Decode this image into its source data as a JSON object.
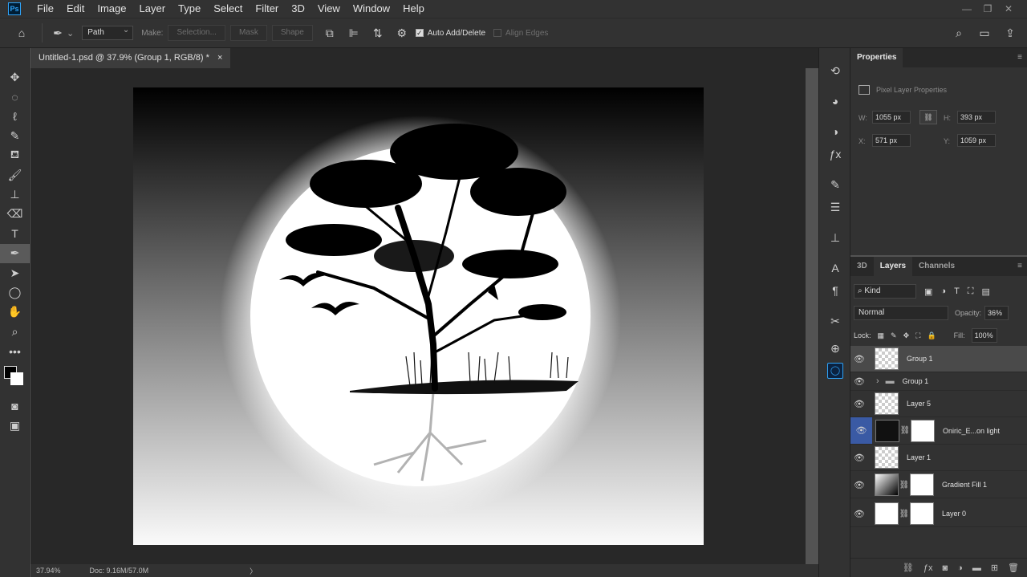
{
  "menubar": {
    "logo": "Ps",
    "items": [
      "File",
      "Edit",
      "Image",
      "Layer",
      "Type",
      "Select",
      "Filter",
      "3D",
      "View",
      "Window",
      "Help"
    ],
    "win_min": "—",
    "win_restore": "❐",
    "win_close": "✕"
  },
  "options": {
    "mode": "Path",
    "make_label": "Make:",
    "selection_btn": "Selection...",
    "mask_btn": "Mask",
    "shape_btn": "Shape",
    "auto_add_delete": "Auto Add/Delete",
    "align_edges": "Align Edges"
  },
  "document": {
    "tab_title": "Untitled-1.psd @ 37.9% (Group 1, RGB/8) *",
    "close": "×",
    "zoom": "37.94%",
    "doc_size": "Doc: 9.16M/57.0M",
    "status_arrow": "〉"
  },
  "properties": {
    "tab": "Properties",
    "section_title": "Pixel Layer Properties",
    "w_label": "W:",
    "w_value": "1055 px",
    "h_label": "H:",
    "h_value": "393 px",
    "x_label": "X:",
    "x_value": "571 px",
    "y_label": "Y:",
    "y_value": "1059 px"
  },
  "layers_panel": {
    "tabs": [
      "3D",
      "Layers",
      "Channels"
    ],
    "kind_filter": "Kind",
    "blend_mode": "Normal",
    "opacity_label": "Opacity:",
    "opacity_value": "36%",
    "lock_label": "Lock:",
    "fill_label": "Fill:",
    "fill_value": "100%",
    "layers": [
      {
        "name": "Group 1"
      },
      {
        "name": "Group 1"
      },
      {
        "name": "Layer 5"
      },
      {
        "name": "Oniric_E...on light"
      },
      {
        "name": "Layer 1"
      },
      {
        "name": "Gradient Fill 1"
      },
      {
        "name": "Layer 0"
      }
    ]
  },
  "colors": {
    "accent": "#2fa3f7",
    "selected_eye": "#3a5aa4"
  }
}
